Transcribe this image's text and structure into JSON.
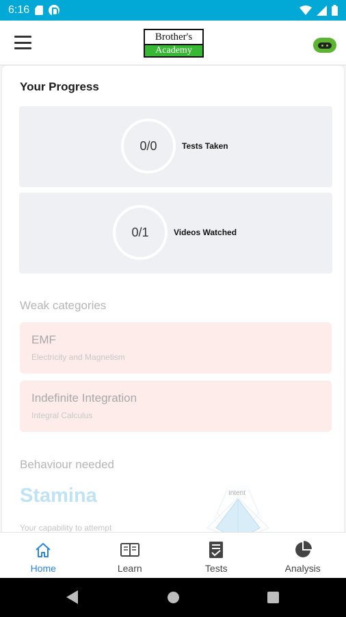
{
  "status_bar": {
    "time": "6:16",
    "icons": [
      "sd-card-icon",
      "p-notification-icon",
      "wifi-icon",
      "signal-icon",
      "battery-icon"
    ]
  },
  "app_bar": {
    "logo_top": "Brother's",
    "logo_bottom": "Academy",
    "menu_icon": "hamburger-menu-icon",
    "avatar_icon": "robot-avatar-icon"
  },
  "progress": {
    "title": "Your Progress",
    "tests": {
      "value": "0/0",
      "label": "Tests Taken"
    },
    "videos": {
      "value": "0/1",
      "label": "Videos Watched"
    }
  },
  "weak": {
    "title": "Weak categories",
    "items": [
      {
        "name": "EMF",
        "sub": "Electricity and Magnetism"
      },
      {
        "name": "Indefinite Integration",
        "sub": "Integral Calculus"
      }
    ]
  },
  "behaviour": {
    "title": "Behaviour needed",
    "headline": "Stamina",
    "description": "Your capability to attempt",
    "radar_label": "Intent"
  },
  "bottom_nav": {
    "items": [
      {
        "label": "Home",
        "icon": "home-icon",
        "active": true
      },
      {
        "label": "Learn",
        "icon": "book-icon",
        "active": false
      },
      {
        "label": "Tests",
        "icon": "tests-icon",
        "active": false
      },
      {
        "label": "Analysis",
        "icon": "pie-chart-icon",
        "active": false
      }
    ]
  },
  "colors": {
    "status_bar": "#03a9d6",
    "accent": "#2a86d9",
    "logo_green": "#38b834",
    "weak_card": "#fdecea",
    "stat_card": "#eef0f3",
    "stamina": "#bfe3f4"
  }
}
